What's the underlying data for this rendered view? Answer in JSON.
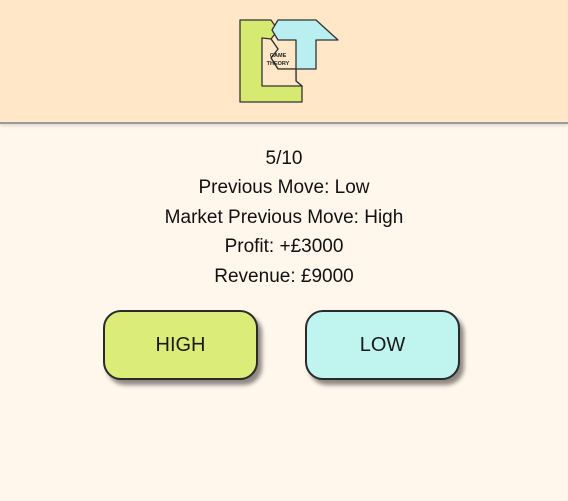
{
  "logo": {
    "line1": "GAME",
    "line2": "THEORY"
  },
  "stats": {
    "round": "5/10",
    "previous_move": "Previous Move: Low",
    "market_previous_move": "Market Previous Move: High",
    "profit": "Profit: +£3000",
    "revenue": "Revenue: £9000"
  },
  "buttons": {
    "high_label": "HIGH",
    "low_label": "LOW"
  },
  "colors": {
    "header_bg": "#ffe7c8",
    "page_bg": "#fff6ec",
    "high_button": "#dcec79",
    "low_button": "#c0f5ef",
    "logo_green": "#d6ea72",
    "logo_blue": "#b9eff0",
    "logo_center": "#ffe7c8"
  }
}
